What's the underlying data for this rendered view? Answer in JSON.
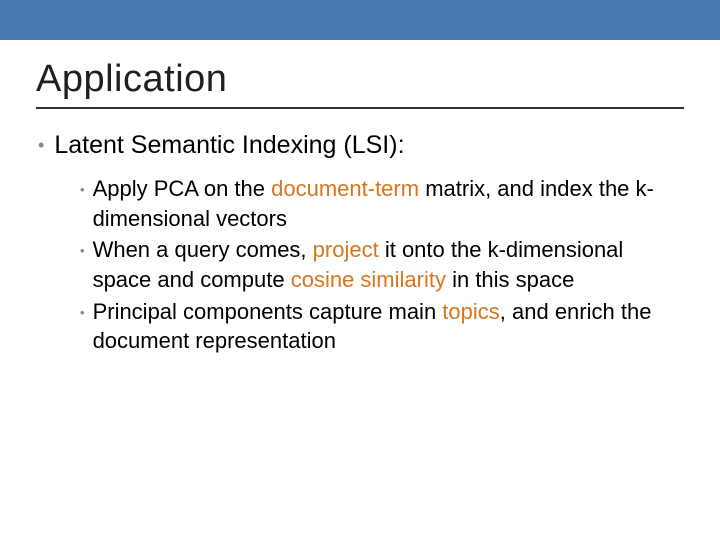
{
  "title": "Application",
  "main": {
    "prefix": "Latent Semantic Indexing",
    "suffix": " (LSI):"
  },
  "sub": [
    {
      "p0": "Apply PCA on the ",
      "h0": "document-term",
      "p1": " matrix, and index the k-dimensional vectors"
    },
    {
      "p0": "When a query comes, ",
      "h0": "project",
      "p1": " it onto the k-dimensional space and compute ",
      "h1": "cosine similarity",
      "p2": " in this space"
    },
    {
      "p0": "Principal components capture main ",
      "h0": "topics",
      "p1": ", and enrich the document representation"
    }
  ]
}
